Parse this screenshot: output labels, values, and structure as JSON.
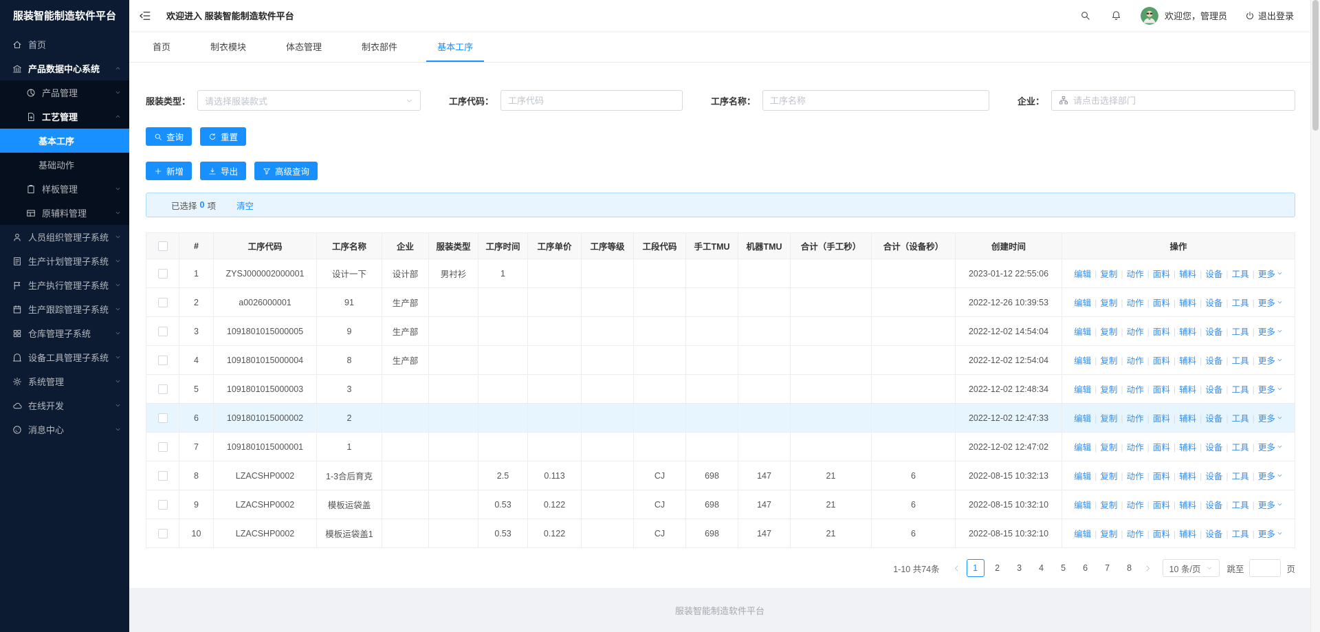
{
  "colors": {
    "primary": "#1890ff",
    "sidebar_bg": "#0c1b31",
    "sidebar_submenu_bg": "#060f1d",
    "selection_bar_bg": "#e8f5ff",
    "selection_bar_border": "#abdcff",
    "highlight_row_bg": "#e7f6fe",
    "avatar_bg": "#55a06a"
  },
  "sidebar": {
    "title": "服装智能制造软件平台",
    "items": [
      {
        "label": "首页",
        "icon": "home-icon",
        "level": 1,
        "chevron": null,
        "sub": false,
        "active": false,
        "bold": false
      },
      {
        "label": "产品数据中心系统",
        "icon": "bank-icon",
        "level": 1,
        "chevron": "up",
        "sub": false,
        "active": false,
        "bold": true
      },
      {
        "label": "产品管理",
        "icon": "pie-chart-icon",
        "level": 2,
        "chevron": "down",
        "sub": true,
        "active": false,
        "bold": false
      },
      {
        "label": "工艺管理",
        "icon": "file-add-icon",
        "level": 2,
        "chevron": "up",
        "sub": true,
        "active": false,
        "bold": true
      },
      {
        "label": "基本工序",
        "icon": null,
        "level": 3,
        "chevron": null,
        "sub": true,
        "active": true,
        "bold": false
      },
      {
        "label": "基础动作",
        "icon": null,
        "level": 3,
        "chevron": null,
        "sub": true,
        "active": false,
        "bold": false
      },
      {
        "label": "样板管理",
        "icon": "clipboard-icon",
        "level": 2,
        "chevron": "down",
        "sub": true,
        "active": false,
        "bold": false
      },
      {
        "label": "原辅料管理",
        "icon": "layout-icon",
        "level": 2,
        "chevron": "down",
        "sub": true,
        "active": false,
        "bold": false
      },
      {
        "label": "人员组织管理子系统",
        "icon": "user-icon",
        "level": 1,
        "chevron": "down",
        "sub": false,
        "active": false,
        "bold": false
      },
      {
        "label": "生产计划管理子系统",
        "icon": "plan-icon",
        "level": 1,
        "chevron": "down",
        "sub": false,
        "active": false,
        "bold": false
      },
      {
        "label": "生产执行管理子系统",
        "icon": "flag-icon",
        "level": 1,
        "chevron": "down",
        "sub": false,
        "active": false,
        "bold": false
      },
      {
        "label": "生产跟踪管理子系统",
        "icon": "calendar-icon",
        "level": 1,
        "chevron": "down",
        "sub": false,
        "active": false,
        "bold": false
      },
      {
        "label": "仓库管理子系统",
        "icon": "grid-icon",
        "level": 1,
        "chevron": "down",
        "sub": false,
        "active": false,
        "bold": false
      },
      {
        "label": "设备工具管理子系统",
        "icon": "device-icon",
        "level": 1,
        "chevron": "down",
        "sub": false,
        "active": false,
        "bold": false
      },
      {
        "label": "系统管理",
        "icon": "gear-icon",
        "level": 1,
        "chevron": "down",
        "sub": false,
        "active": false,
        "bold": false
      },
      {
        "label": "在线开发",
        "icon": "cloud-icon",
        "level": 1,
        "chevron": "down",
        "sub": false,
        "active": false,
        "bold": false
      },
      {
        "label": "消息中心",
        "icon": "message-icon",
        "level": 1,
        "chevron": "down",
        "sub": false,
        "active": false,
        "bold": false
      }
    ]
  },
  "header": {
    "welcome": "欢迎进入 服装智能制造软件平台",
    "greeting": "欢迎您，管理员",
    "logout": "退出登录"
  },
  "tabs": [
    {
      "label": "首页",
      "active": false
    },
    {
      "label": "制衣模块",
      "active": false
    },
    {
      "label": "体态管理",
      "active": false
    },
    {
      "label": "制衣部件",
      "active": false
    },
    {
      "label": "基本工序",
      "active": true
    }
  ],
  "filters": [
    {
      "label": "服装类型：",
      "placeholder": "请选择服装款式",
      "type": "select"
    },
    {
      "label": "工序代码：",
      "placeholder": "工序代码",
      "type": "input"
    },
    {
      "label": "工序名称：",
      "placeholder": "工序名称",
      "type": "input"
    },
    {
      "label": "企业：",
      "placeholder": "请点击选择部门",
      "type": "tree-input"
    }
  ],
  "actions": {
    "search": "查询",
    "reset": "重置",
    "add": "新增",
    "export": "导出",
    "advanced": "高级查询"
  },
  "selection_bar": {
    "prefix": "已选择",
    "count": "0",
    "suffix": "项",
    "clear": "清空"
  },
  "table": {
    "columns": [
      "#",
      "工序代码",
      "工序名称",
      "企业",
      "服装类型",
      "工序时间",
      "工序单价",
      "工序等级",
      "工段代码",
      "手工TMU",
      "机器TMU",
      "合计（手工秒）",
      "合计（设备秒）",
      "创建时间",
      "操作"
    ],
    "op_labels": [
      "编辑",
      "复制",
      "动作",
      "面料",
      "辅料",
      "设备",
      "工具",
      "更多"
    ],
    "rows": [
      {
        "highlighted": false,
        "cells": [
          "1",
          "ZYSJ000002000001",
          "设计一下",
          "设计部",
          "男衬衫",
          "1",
          "",
          "",
          "",
          "",
          "",
          "",
          "",
          "2023-01-12 22:55:06"
        ]
      },
      {
        "highlighted": false,
        "cells": [
          "2",
          "a0026000001",
          "91",
          "生产部",
          "",
          "",
          "",
          "",
          "",
          "",
          "",
          "",
          "",
          "2022-12-26 10:39:53"
        ]
      },
      {
        "highlighted": false,
        "cells": [
          "3",
          "1091801015000005",
          "9",
          "生产部",
          "",
          "",
          "",
          "",
          "",
          "",
          "",
          "",
          "",
          "2022-12-02 14:54:04"
        ]
      },
      {
        "highlighted": false,
        "cells": [
          "4",
          "1091801015000004",
          "8",
          "生产部",
          "",
          "",
          "",
          "",
          "",
          "",
          "",
          "",
          "",
          "2022-12-02 12:54:04"
        ]
      },
      {
        "highlighted": false,
        "cells": [
          "5",
          "1091801015000003",
          "3",
          "",
          "",
          "",
          "",
          "",
          "",
          "",
          "",
          "",
          "",
          "2022-12-02 12:48:34"
        ]
      },
      {
        "highlighted": true,
        "cells": [
          "6",
          "1091801015000002",
          "2",
          "",
          "",
          "",
          "",
          "",
          "",
          "",
          "",
          "",
          "",
          "2022-12-02 12:47:33"
        ]
      },
      {
        "highlighted": false,
        "cells": [
          "7",
          "1091801015000001",
          "1",
          "",
          "",
          "",
          "",
          "",
          "",
          "",
          "",
          "",
          "",
          "2022-12-02 12:47:02"
        ]
      },
      {
        "highlighted": false,
        "cells": [
          "8",
          "LZACSHP0002",
          "1-3合后育克",
          "",
          "",
          "2.5",
          "0.113",
          "",
          "CJ",
          "698",
          "147",
          "21",
          "6",
          "2022-08-15 10:32:13"
        ]
      },
      {
        "highlighted": false,
        "cells": [
          "9",
          "LZACSHP0002",
          "模板运袋盖",
          "",
          "",
          "0.53",
          "0.122",
          "",
          "CJ",
          "698",
          "147",
          "21",
          "6",
          "2022-08-15 10:32:10"
        ]
      },
      {
        "highlighted": false,
        "cells": [
          "10",
          "LZACSHP0002",
          "模板运袋盖1",
          "",
          "",
          "0.53",
          "0.122",
          "",
          "CJ",
          "698",
          "147",
          "21",
          "6",
          "2022-08-15 10:32:10"
        ]
      }
    ]
  },
  "pagination": {
    "total": "1-10 共74条",
    "pages": [
      "1",
      "2",
      "3",
      "4",
      "5",
      "6",
      "7",
      "8"
    ],
    "active_page": "1",
    "page_size": "10 条/页",
    "jump_prefix": "跳至",
    "jump_suffix": "页"
  },
  "footer": {
    "text": "服装智能制造软件平台"
  }
}
